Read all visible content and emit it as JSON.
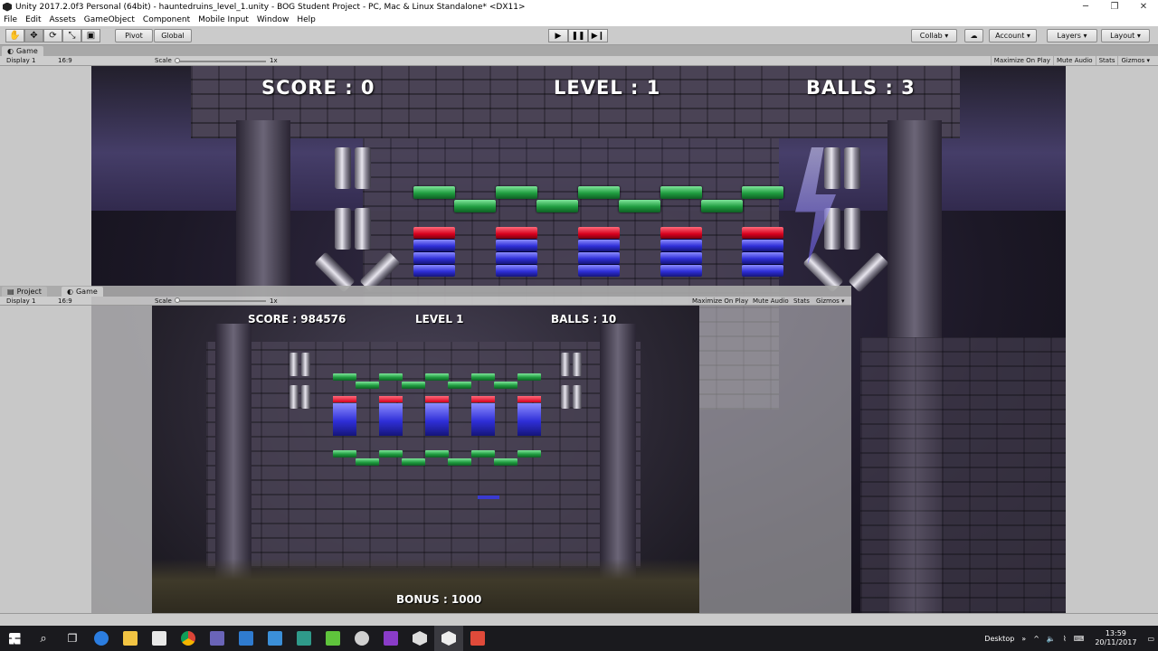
{
  "window": {
    "title": "Unity 2017.2.0f3 Personal (64bit) - hauntedruins_level_1.unity - BOG Student Project - PC, Mac & Linux Standalone* <DX11>",
    "minimize": "─",
    "maximize": "❐",
    "close": "✕"
  },
  "menu": [
    "File",
    "Edit",
    "Assets",
    "GameObject",
    "Component",
    "Mobile Input",
    "Window",
    "Help"
  ],
  "toolbar": {
    "pivot": "Pivot",
    "global": "Global",
    "collab": "Collab ▾",
    "account": "Account ▾",
    "layers": "Layers ▾",
    "layout": "Layout ▾"
  },
  "game_panel": {
    "tab": "Game",
    "display": "Display 1",
    "aspect": "16:9",
    "scale_label": "Scale",
    "scale_value": "1x",
    "maximize_on_play": "Maximize On Play",
    "mute_audio": "Mute Audio",
    "stats": "Stats",
    "gizmos": "Gizmos ▾"
  },
  "hud_main": {
    "score": "SCORE : 0",
    "level": "LEVEL : 1",
    "balls": "BALLS : 3"
  },
  "floating_panel": {
    "tab_project": "Project",
    "tab_game": "Game",
    "display": "Display 1",
    "aspect": "16:9",
    "scale_label": "Scale",
    "scale_value": "1x",
    "maximize_on_play": "Maximize On Play",
    "mute_audio": "Mute Audio",
    "stats": "Stats",
    "gizmos": "Gizmos ▾"
  },
  "hud_small": {
    "score": "SCORE : 984576",
    "level": "LEVEL 1",
    "balls": "BALLS : 10",
    "bonus": "BONUS : 1000"
  },
  "taskbar": {
    "desktop": "Desktop",
    "time": "13:59",
    "date": "20/11/2017"
  },
  "colors": {
    "brick_green": "#1f9c3f",
    "brick_red": "#d6001d",
    "brick_blue": "#2f2fd8"
  }
}
